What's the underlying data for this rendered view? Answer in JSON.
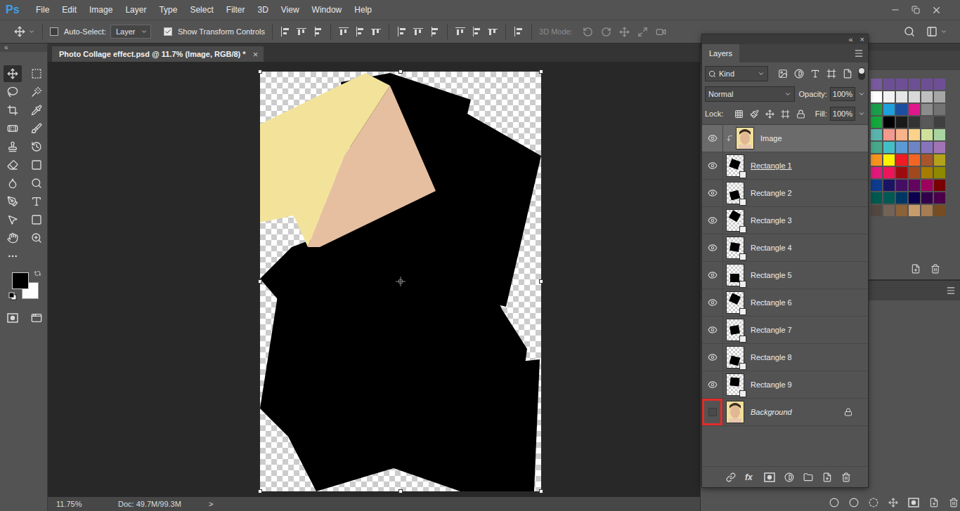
{
  "app": {
    "logo": "Ps"
  },
  "menu": [
    "File",
    "Edit",
    "Image",
    "Layer",
    "Type",
    "Select",
    "Filter",
    "3D",
    "View",
    "Window",
    "Help"
  ],
  "toolbar": {
    "collapse": "«"
  },
  "tools": [
    {
      "selected": true
    },
    {
      "selected": false
    },
    {
      "selected": false
    },
    {
      "selected": false
    },
    {
      "selected": false
    },
    {
      "selected": false
    },
    {
      "selected": false
    },
    {
      "selected": false
    },
    {
      "selected": false
    },
    {
      "selected": false
    },
    {
      "selected": false
    },
    {
      "selected": false
    },
    {
      "selected": false
    },
    {
      "selected": false
    },
    {
      "selected": false
    },
    {
      "selected": false
    },
    {
      "selected": false
    },
    {
      "selected": false
    },
    {
      "selected": false
    },
    {
      "selected": false
    }
  ],
  "options": {
    "auto_select": {
      "label": "Auto-Select:",
      "checked": false
    },
    "target": "Layer",
    "transform_controls": {
      "label": "Show Transform Controls",
      "checked": true
    },
    "mode_3d": {
      "label": "3D Mode:",
      "disabled": true
    }
  },
  "document": {
    "title": "Photo Collage effect.psd @ 11.7% (Image, RGB/8) *",
    "close": "×",
    "selected": true
  },
  "status_bar": {
    "zoom": "11.75%",
    "doc": "Doc: 49.7M/99.3M",
    "more": ">"
  },
  "layers_panel": {
    "collapse": "«",
    "close": "×",
    "tab": "Layers",
    "filter": "Kind",
    "blend_mode": "Normal",
    "opacity_label": "Opacity:",
    "opacity": "100%",
    "lock_label": "Lock:",
    "fill_label": "Fill:",
    "fill": "100%",
    "fx": "fx"
  },
  "layers": [
    {
      "name": "Image",
      "kind": "image",
      "visible": true,
      "selected": true,
      "clipped": true,
      "underlined": false,
      "locked": false,
      "italic": false,
      "highlighted": false
    },
    {
      "name": "Rectangle 1",
      "kind": "shape",
      "visible": true,
      "selected": false,
      "clipped": false,
      "underlined": true,
      "locked": false,
      "italic": false,
      "highlighted": false
    },
    {
      "name": "Rectangle 2",
      "kind": "shape",
      "visible": true,
      "selected": false,
      "clipped": false,
      "underlined": false,
      "locked": false,
      "italic": false,
      "highlighted": false
    },
    {
      "name": "Rectangle 3",
      "kind": "shape",
      "visible": true,
      "selected": false,
      "clipped": false,
      "underlined": false,
      "locked": false,
      "italic": false,
      "highlighted": false
    },
    {
      "name": "Rectangle 4",
      "kind": "shape",
      "visible": true,
      "selected": false,
      "clipped": false,
      "underlined": false,
      "locked": false,
      "italic": false,
      "highlighted": false
    },
    {
      "name": "Rectangle 5",
      "kind": "shape",
      "visible": true,
      "selected": false,
      "clipped": false,
      "underlined": false,
      "locked": false,
      "italic": false,
      "highlighted": false
    },
    {
      "name": "Rectangle 6",
      "kind": "shape",
      "visible": true,
      "selected": false,
      "clipped": false,
      "underlined": false,
      "locked": false,
      "italic": false,
      "highlighted": false
    },
    {
      "name": "Rectangle 7",
      "kind": "shape",
      "visible": true,
      "selected": false,
      "clipped": false,
      "underlined": false,
      "locked": false,
      "italic": false,
      "highlighted": false
    },
    {
      "name": "Rectangle 8",
      "kind": "shape",
      "visible": true,
      "selected": false,
      "clipped": false,
      "underlined": false,
      "locked": false,
      "italic": false,
      "highlighted": false
    },
    {
      "name": "Rectangle 9",
      "kind": "shape",
      "visible": true,
      "selected": false,
      "clipped": false,
      "underlined": false,
      "locked": false,
      "italic": false,
      "highlighted": false
    },
    {
      "name": "Background",
      "kind": "background",
      "visible": false,
      "selected": false,
      "clipped": false,
      "underlined": false,
      "locked": true,
      "italic": true,
      "highlighted": true
    }
  ],
  "swatches": [
    {
      "cells": [
        {
          "color": "#7a5a9e"
        },
        {
          "color": "#6e4f96"
        },
        {
          "color": "#6e4f96"
        },
        {
          "color": "#6e4f96"
        },
        {
          "color": "#6e4f96"
        },
        {
          "color": "#6e4f96"
        }
      ]
    },
    {
      "cells": [
        {
          "color": "#ffffff"
        },
        {
          "color": "#f2f2f2"
        },
        {
          "color": "#e6e6e6"
        },
        {
          "color": "#d9d9d9"
        },
        {
          "color": "#bfbfbf"
        },
        {
          "color": "#a6a6a6"
        }
      ]
    },
    {
      "cells": [
        {
          "color": "#1b9e4b"
        },
        {
          "color": "#1ea0dc"
        },
        {
          "color": "#1c4fa0"
        },
        {
          "color": "#e0178c"
        },
        {
          "color": "#8c8c8c"
        },
        {
          "color": "#737373"
        }
      ]
    },
    {
      "cells": [
        {
          "color": "#14a83c"
        },
        {
          "color": "#000000"
        },
        {
          "color": "#1a1a1a"
        },
        {
          "color": "#333333"
        },
        {
          "color": "#595959"
        },
        {
          "color": "#404040"
        }
      ]
    },
    {
      "cells": [
        {
          "color": "#5ab4ac"
        },
        {
          "color": "#f4998d"
        },
        {
          "color": "#f8b38b"
        },
        {
          "color": "#fbd28b"
        },
        {
          "color": "#cfe09a"
        },
        {
          "color": "#a8d4a0"
        }
      ]
    },
    {
      "cells": [
        {
          "color": "#47a88a"
        },
        {
          "color": "#42bfc6"
        },
        {
          "color": "#5b9bd5"
        },
        {
          "color": "#6e85c5"
        },
        {
          "color": "#8874bd"
        },
        {
          "color": "#a374b5"
        }
      ]
    },
    {
      "cells": [
        {
          "color": "#f7941d"
        },
        {
          "color": "#fff200"
        },
        {
          "color": "#ef1c24"
        },
        {
          "color": "#f26522"
        },
        {
          "color": "#a8552b"
        },
        {
          "color": "#b4a21a"
        }
      ]
    },
    {
      "cells": [
        {
          "color": "#e1197a"
        },
        {
          "color": "#ed145b"
        },
        {
          "color": "#9e0b0f"
        },
        {
          "color": "#a2471e"
        },
        {
          "color": "#a67c00"
        },
        {
          "color": "#8d8a00"
        }
      ]
    },
    {
      "cells": [
        {
          "color": "#0d3b8e"
        },
        {
          "color": "#1b1464"
        },
        {
          "color": "#440e62"
        },
        {
          "color": "#630460"
        },
        {
          "color": "#9e005d"
        },
        {
          "color": "#790000"
        }
      ]
    },
    {
      "cells": [
        {
          "color": "#00594f"
        },
        {
          "color": "#005952"
        },
        {
          "color": "#003663"
        },
        {
          "color": "#0d004c"
        },
        {
          "color": "#32004b"
        },
        {
          "color": "#4b0049"
        }
      ]
    },
    {
      "cells": [
        {
          "color": "#534741"
        },
        {
          "color": "#736357"
        },
        {
          "color": "#8c6239"
        },
        {
          "color": "#c69c6d"
        },
        {
          "color": "#a67c52"
        },
        {
          "color": "#754c24"
        }
      ]
    }
  ]
}
